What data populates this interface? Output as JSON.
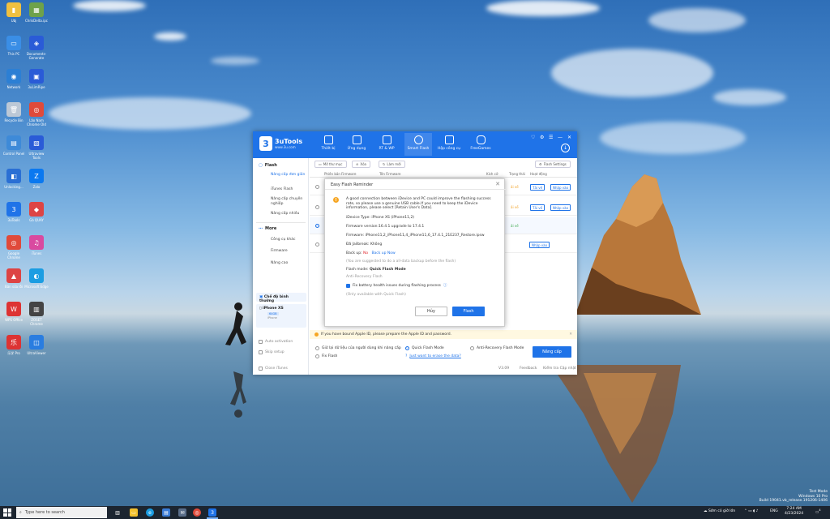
{
  "desktop": {
    "icons": [
      {
        "label": "Ubj",
        "color": "#f0c040",
        "glyph": "▮"
      },
      {
        "label": "ChrisDelta.ipc",
        "color": "#6ea24a",
        "glyph": "▦"
      },
      {
        "label": "This PC",
        "color": "#3a8ee6",
        "glyph": "▭"
      },
      {
        "label": "Documents-Generate",
        "color": "#2a5bd7",
        "glyph": "◈"
      },
      {
        "label": "Network",
        "color": "#2c7fd4",
        "glyph": "◉"
      },
      {
        "label": "3uLimRipe",
        "color": "#2a5bd7",
        "glyph": "▣"
      },
      {
        "label": "Recycle Bin",
        "color": "#bcc8d6",
        "glyph": "🗑"
      },
      {
        "label": "Lão Nam Chrome Old",
        "color": "#e04a3a",
        "glyph": "◎"
      },
      {
        "label": "Control Panel",
        "color": "#3e8ad8",
        "glyph": "▤"
      },
      {
        "label": "Ultraview Tools",
        "color": "#2a5bd7",
        "glyph": "▧"
      },
      {
        "label": "Unlocking...",
        "color": "#2a6fd4",
        "glyph": "◧"
      },
      {
        "label": "Zalo",
        "color": "#0a78f0",
        "glyph": "Z"
      },
      {
        "label": "3uTools",
        "color": "#1f73e8",
        "glyph": "3"
      },
      {
        "label": "Gà QUAY",
        "color": "#d44",
        "glyph": "◆"
      },
      {
        "label": "Google Chrome",
        "color": "#e04a3a",
        "glyph": "◎"
      },
      {
        "label": "iTunes",
        "color": "#d94aa0",
        "glyph": "♫"
      },
      {
        "label": "Bản sửa lỗi",
        "color": "#d44",
        "glyph": "▲"
      },
      {
        "label": "Microsoft Edge",
        "color": "#1b9de2",
        "glyph": "◐"
      },
      {
        "label": "WPS Office",
        "color": "#d33",
        "glyph": "W"
      },
      {
        "label": "ZOSET Chrome",
        "color": "#444",
        "glyph": "▥"
      },
      {
        "label": "乐学 Pro",
        "color": "#d33",
        "glyph": "乐"
      },
      {
        "label": "UltraViewer",
        "color": "#2a7de0",
        "glyph": "◫"
      }
    ]
  },
  "app": {
    "logo_mark": "3",
    "name": "3uTools",
    "site": "www.3u.com",
    "nav": [
      {
        "label": "Thiết bị"
      },
      {
        "label": "Ứng dụng"
      },
      {
        "label": "RT & WP"
      },
      {
        "label": "Smart Flash"
      },
      {
        "label": "Hộp công cụ"
      },
      {
        "label": "FreeGames"
      }
    ],
    "sidebar": {
      "flash_header": "Flash",
      "flash_items": [
        "Nâng cấp đơn giản",
        "iTunes Flash",
        "Nâng cấp chuyên nghiệp",
        "Nâng cấp nhiều"
      ],
      "more_header": "More",
      "more_items": [
        "Công cụ khác",
        "Firmware",
        "Nâng cao"
      ],
      "mode_label": "Chế độ bình thường",
      "device_name": "iPhone XS",
      "device_storage": "64GB",
      "device_type": "iPhone",
      "auto_activation": "Auto activation",
      "skip_setup": "Skip setup",
      "close_itunes": "Close iTunes"
    },
    "toolbar": {
      "open_folder": "Mở thư mục",
      "delete": "Xóa",
      "refresh": "Làm mới",
      "flash_settings": "Flash Settings"
    },
    "table": {
      "headers": [
        "Phiên bản Firmware",
        "Tên Firmware",
        "Kích cỡ",
        "Trạng thái",
        "Hoạt động"
      ],
      "rows": [
        {
          "status": "ải về",
          "status_color": "#f0a020",
          "actions": [
            "Tải về",
            "Nhập vào"
          ]
        },
        {
          "status": "ải về",
          "status_color": "#f0a020",
          "actions": [
            "Tải về",
            "Nhập vào"
          ]
        },
        {
          "status": "ải về",
          "status_color": "#3aa84a",
          "actions": []
        },
        {
          "status": "",
          "status_color": "#333",
          "actions": [
            "Nhập vào"
          ]
        }
      ]
    },
    "banner": "If you have bound Apple ID, please prepare the Apple ID and password.",
    "options": {
      "keep_data": "Giữ lại dữ liệu của người dùng khi nâng cấp",
      "quick_flash": "Quick Flash Mode",
      "anti_recovery": "Anti-Recovery Flash Mode",
      "fix_flash": "Fix Flash",
      "erase_link": "Just want to erase the data?",
      "upgrade_button": "Nâng cấp"
    },
    "footer": {
      "version": "V3.09",
      "feedback": "Feedback",
      "check_update": "Kiểm tra Cập nhật"
    }
  },
  "dialog": {
    "title": "Easy Flash Reminder",
    "intro": "A good connection between iDevice and PC could improve the flashing success rate, so please use a genuine USB cable.If you need to keep the iDevice information, please select [Retain User's Data].",
    "idevice_type": "iDevice Type: iPhone XS (iPhone11,2)",
    "firmware_version": "Firmware version:16.4.1 upgrade to 17.4.1",
    "firmware": "Firmware: iPhone11,2_iPhone11,4_iPhone11,6_17.4.1_21E237_Restore.ipsw",
    "jailbreak": "Đã Jailbreak: Không",
    "backup_prefix": "Back up: ",
    "backup_value": "No",
    "backup_link": "Back up Now",
    "backup_hint": "(You are suggested to do a all-data backup before the flash)",
    "flash_mode_prefix": "Flash mode: ",
    "flash_mode_value": "Quick Flash Mode",
    "anti_recovery": "Anti-Recovery Flash",
    "fix_battery": "Fix battery health issues during flashing process",
    "only_quick": "(Only available with Quick Flash)",
    "cancel": "Hủy",
    "flash": "Flash"
  },
  "taskbar": {
    "search_placeholder": "Type here to search",
    "weather": "Sớm có giờ lớn",
    "lang": "ENG",
    "time": "7:24 AM",
    "date": "4/23/2024",
    "notif_count": "4"
  },
  "watermark": {
    "line1": "Test Mode",
    "line2": "Windows 10 Pro",
    "line3": "Build 19041.vb_release.191206-1406"
  }
}
